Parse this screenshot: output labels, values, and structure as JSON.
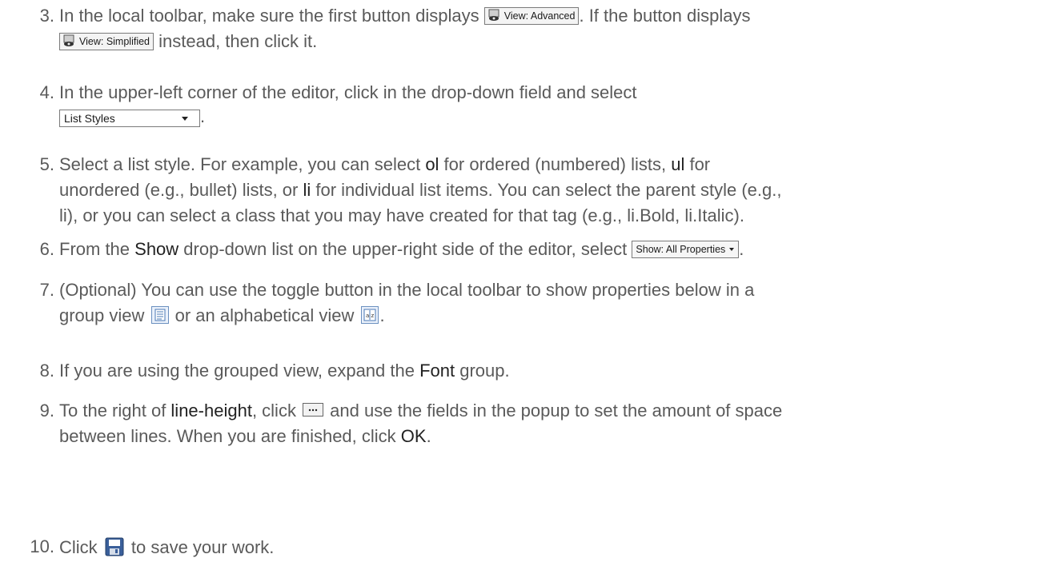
{
  "steps": [
    {
      "number": "3.",
      "t1": "In the local toolbar, make sure the first button displays ",
      "btn1": "View: Advanced",
      "t2": ". If the button displays",
      "btn2": "View: Simplified",
      "t3": " instead, then click it."
    },
    {
      "number": "4.",
      "t1": "In the upper-left corner of the editor, click in the drop-down field and select",
      "dropdown": "List Styles",
      "t2": "."
    },
    {
      "number": "5.",
      "t1": "Select a list style. For example, you can select ",
      "k1": "ol",
      "t2": " for ordered (numbered) lists, ",
      "k2": "ul",
      "t3": " for",
      "t4": "unordered (e.g., bullet) lists, or ",
      "k3": "li",
      "t5": " for individual list items. You can select the parent style (e.g.,",
      "t6": "li), or you can select a class that you may have created for that tag (e.g., li.Bold, li.Italic)."
    },
    {
      "number": "6.",
      "t1": "From the ",
      "k1": "Show",
      "t2": " drop-down list on the upper-right side of the editor, select ",
      "dropdown": "Show: All Properties",
      "t3": "."
    },
    {
      "number": "7.",
      "t1": "(Optional) You can use the toggle button in the local toolbar to show properties below in a",
      "t2": "group view ",
      "t3": " or an alphabetical view ",
      "t4": "."
    },
    {
      "number": "8.",
      "t1": "If you are using the grouped view, expand the ",
      "k1": "Font",
      "t2": " group."
    },
    {
      "number": "9.",
      "t1": "To the right of ",
      "k1": "line-height",
      "t2": ", click ",
      "t3": " and use the fields in the popup to set the amount of space",
      "t4": "between lines. When you are finished, click ",
      "k2": "OK",
      "t5": "."
    },
    {
      "number": "10.",
      "t1": "Click ",
      "t2": " to save your work."
    }
  ],
  "icons": {
    "view_button_icon": "eye-icon",
    "group_view_icon": "group-view-icon",
    "alphabetical_view_icon": "alphabetical-view-icon",
    "ellipsis_button_icon": "ellipsis-icon",
    "save_icon": "save-icon"
  },
  "colors": {
    "text": "#5a5a5a",
    "keyword": "#222222"
  }
}
